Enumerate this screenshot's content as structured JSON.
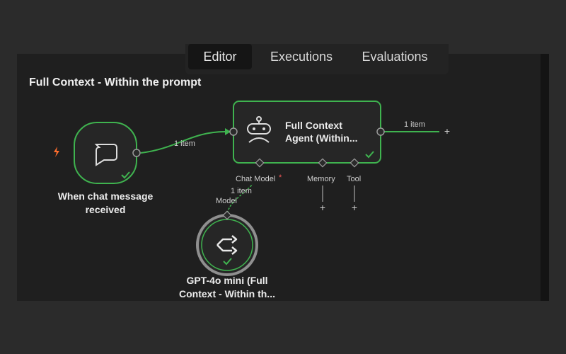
{
  "tabs": [
    {
      "label": "Editor",
      "active": true
    },
    {
      "label": "Executions",
      "active": false
    },
    {
      "label": "Evaluations",
      "active": false
    }
  ],
  "workflow": {
    "title": "Full Context - Within the prompt"
  },
  "nodes": {
    "trigger": {
      "caption_line1": "When chat message",
      "caption_line2": "received",
      "icon": "chat-bubble-icon",
      "status": "success"
    },
    "agent": {
      "title_line1": "Full Context",
      "title_line2": "Agent (Within...",
      "icon": "robot-icon",
      "status": "success"
    },
    "model": {
      "caption_line1": "GPT-4o mini (Full",
      "caption_line2": "Context - Within th...",
      "icon": "openai-model-icon",
      "status": "success"
    }
  },
  "connections": {
    "trigger_to_agent": "1 item",
    "agent_output": "1 item",
    "model_to_agent": "1 item"
  },
  "ports": {
    "chat_model": "Chat Model",
    "chat_model_required": "*",
    "memory": "Memory",
    "tool": "Tool",
    "model_output": "Model"
  },
  "colors": {
    "success": "#3fb34f",
    "trigger_bolt": "#ff6d2d",
    "required": "#ff5a5a"
  }
}
